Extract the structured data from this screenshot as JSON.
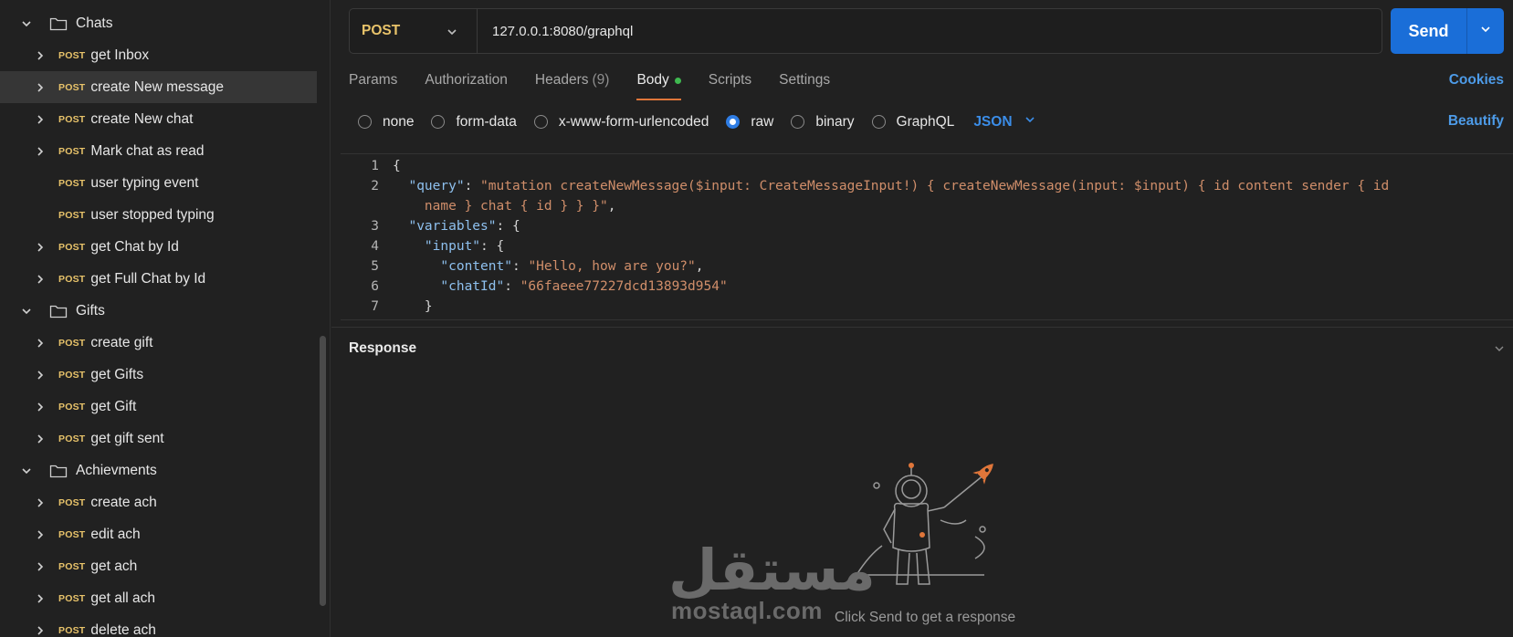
{
  "sidebar": {
    "items": [
      {
        "type": "folder",
        "label": "Chats"
      },
      {
        "type": "request",
        "method": "POST",
        "label": "get Inbox",
        "expandable": true
      },
      {
        "type": "request",
        "method": "POST",
        "label": "create New message",
        "expandable": true,
        "selected": true
      },
      {
        "type": "request",
        "method": "POST",
        "label": "create New chat",
        "expandable": true
      },
      {
        "type": "request",
        "method": "POST",
        "label": "Mark chat as read",
        "expandable": true
      },
      {
        "type": "request",
        "method": "POST",
        "label": "user typing event",
        "expandable": false
      },
      {
        "type": "request",
        "method": "POST",
        "label": "user stopped typing",
        "expandable": false
      },
      {
        "type": "request",
        "method": "POST",
        "label": "get Chat by Id",
        "expandable": true
      },
      {
        "type": "request",
        "method": "POST",
        "label": "get Full Chat by Id",
        "expandable": true
      },
      {
        "type": "folder",
        "label": "Gifts"
      },
      {
        "type": "request",
        "method": "POST",
        "label": "create gift",
        "expandable": true
      },
      {
        "type": "request",
        "method": "POST",
        "label": "get Gifts",
        "expandable": true
      },
      {
        "type": "request",
        "method": "POST",
        "label": "get Gift",
        "expandable": true
      },
      {
        "type": "request",
        "method": "POST",
        "label": "get gift sent",
        "expandable": true
      },
      {
        "type": "folder",
        "label": "Achievments"
      },
      {
        "type": "request",
        "method": "POST",
        "label": "create ach",
        "expandable": true
      },
      {
        "type": "request",
        "method": "POST",
        "label": "edit ach",
        "expandable": true
      },
      {
        "type": "request",
        "method": "POST",
        "label": "get ach",
        "expandable": true
      },
      {
        "type": "request",
        "method": "POST",
        "label": "get all ach",
        "expandable": true
      },
      {
        "type": "request",
        "method": "POST",
        "label": "delete ach",
        "expandable": true
      }
    ]
  },
  "request": {
    "method": "POST",
    "url": "127.0.0.1:8080/graphql",
    "send_label": "Send"
  },
  "tabs": [
    {
      "label": "Params",
      "count": ""
    },
    {
      "label": "Authorization",
      "count": ""
    },
    {
      "label": "Headers",
      "count": "(9)"
    },
    {
      "label": "Body",
      "count": "",
      "active": true
    },
    {
      "label": "Scripts",
      "count": ""
    },
    {
      "label": "Settings",
      "count": ""
    }
  ],
  "cookies_label": "Cookies",
  "body_types": [
    {
      "label": "none",
      "checked": false
    },
    {
      "label": "form-data",
      "checked": false
    },
    {
      "label": "x-www-form-urlencoded",
      "checked": false
    },
    {
      "label": "raw",
      "checked": true
    },
    {
      "label": "binary",
      "checked": false
    },
    {
      "label": "GraphQL",
      "checked": false
    }
  ],
  "format_label": "JSON",
  "beautify_label": "Beautify",
  "editor": {
    "lines": [
      {
        "num": "1",
        "text": "{"
      },
      {
        "num": "2",
        "text": "  \"query\": \"mutation createNewMessage($input: CreateMessageInput!) { createNewMessage(input: $input) { id content sender { id"
      },
      {
        "num": "",
        "text": "    name } chat { id } } }\","
      },
      {
        "num": "3",
        "text": "  \"variables\": {"
      },
      {
        "num": "4",
        "text": "    \"input\": {"
      },
      {
        "num": "5",
        "text": "      \"content\": \"Hello, how are you?\","
      },
      {
        "num": "6",
        "text": "      \"chatId\": \"66faeee77227dcd13893d954\""
      },
      {
        "num": "7",
        "text": "    }"
      }
    ]
  },
  "response": {
    "title": "Response",
    "empty_text": "Click Send to get a response"
  },
  "watermark": {
    "arabic": "مستقل",
    "latin": "mostaql.com"
  },
  "colors": {
    "accent": "#1a6ed8",
    "method": "#e8c36a",
    "tab_indicator": "#e0763a",
    "link": "#4d9be8"
  }
}
